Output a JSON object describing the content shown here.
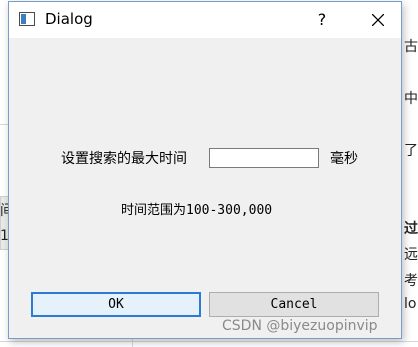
{
  "dialog": {
    "title": "Dialog",
    "help_label": "?",
    "max_time_label": "设置搜索的最大时间",
    "max_time_value": "",
    "unit_label": "毫秒",
    "range_hint": "时间范围为100-300,000",
    "ok_label": "OK",
    "cancel_label": "Cancel"
  },
  "background": {
    "fragments": [
      "古",
      "中",
      "了",
      "间",
      "1",
      "过",
      "远",
      "考",
      "lo"
    ]
  },
  "watermark": "CSDN @biyezuopinvip",
  "colors": {
    "dialog_bg": "#f0f0f0",
    "titlebar_bg": "#ffffff",
    "ok_border": "#2a7ad6"
  }
}
